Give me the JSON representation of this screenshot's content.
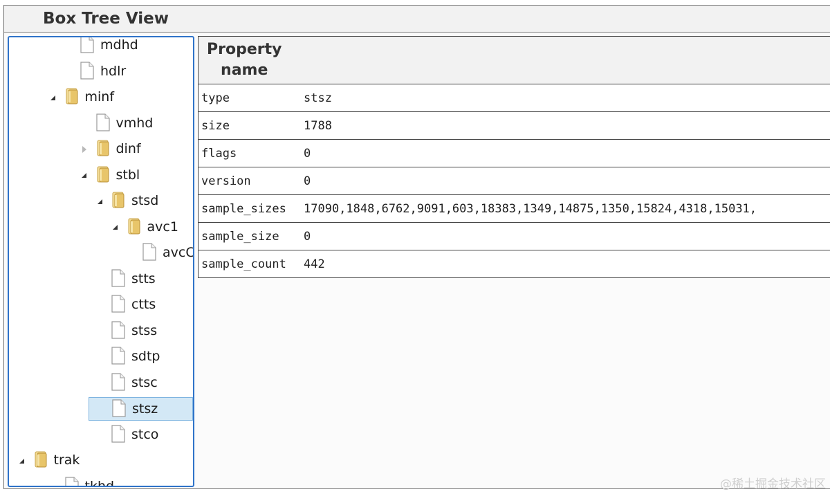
{
  "window": {
    "title": "Box Tree View"
  },
  "tree": {
    "items": [
      {
        "label": "mdhd",
        "icon": "file-icon"
      },
      {
        "label": "hdlr",
        "icon": "file-icon"
      },
      {
        "label": "minf",
        "icon": "folder-icon",
        "state": "expanded"
      },
      {
        "label": "vmhd",
        "icon": "file-icon"
      },
      {
        "label": "dinf",
        "icon": "folder-icon",
        "state": "collapsed"
      },
      {
        "label": "stbl",
        "icon": "folder-icon",
        "state": "expanded"
      },
      {
        "label": "stsd",
        "icon": "folder-icon",
        "state": "expanded"
      },
      {
        "label": "avc1",
        "icon": "folder-icon",
        "state": "expanded"
      },
      {
        "label": "avcC",
        "icon": "file-icon"
      },
      {
        "label": "stts",
        "icon": "file-icon"
      },
      {
        "label": "ctts",
        "icon": "file-icon"
      },
      {
        "label": "stss",
        "icon": "file-icon"
      },
      {
        "label": "sdtp",
        "icon": "file-icon"
      },
      {
        "label": "stsc",
        "icon": "file-icon"
      },
      {
        "label": "stsz",
        "icon": "file-icon",
        "selected": true
      },
      {
        "label": "stco",
        "icon": "file-icon"
      },
      {
        "label": "trak",
        "icon": "folder-icon",
        "state": "expanded"
      },
      {
        "label": "tkhd",
        "icon": "file-icon"
      }
    ]
  },
  "properties": {
    "header": "Property name",
    "rows": [
      {
        "name": "type",
        "value": "stsz"
      },
      {
        "name": "size",
        "value": "1788"
      },
      {
        "name": "flags",
        "value": "0"
      },
      {
        "name": "version",
        "value": "0"
      },
      {
        "name": "sample_sizes",
        "value": "17090,1848,6762,9091,603,18383,1349,14875,1350,15824,4318,15031,"
      },
      {
        "name": "sample_size",
        "value": "0"
      },
      {
        "name": "sample_count",
        "value": "442"
      }
    ]
  },
  "watermark": "@稀土掘金技术社区",
  "colors": {
    "selection": "#d3e8f6",
    "panel_border": "#2f73c9",
    "folder": "#e8c56a"
  }
}
